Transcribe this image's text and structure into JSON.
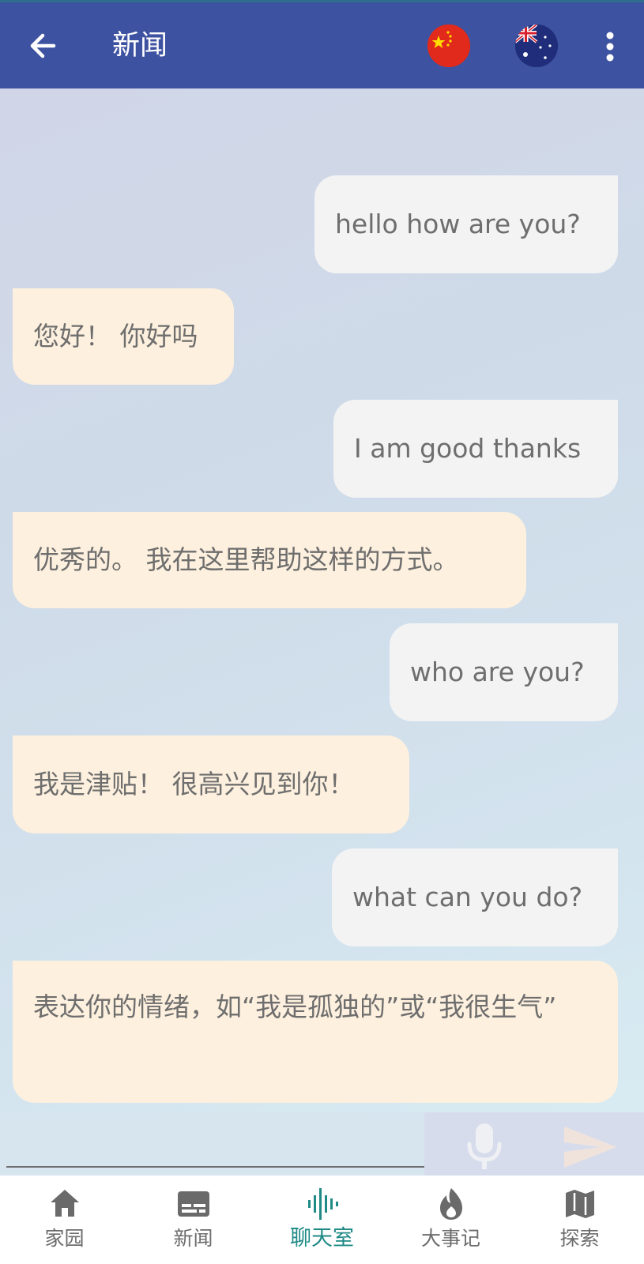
{
  "appbar": {
    "title": "新闻",
    "back_icon": "arrow-left-icon",
    "source_flag": "china-flag",
    "target_flag": "australia-flag",
    "menu_icon": "more-vertical-icon"
  },
  "messages": [
    {
      "side": "sent",
      "text": "hello how are you?"
    },
    {
      "side": "recv",
      "text": "您好！ 你好吗"
    },
    {
      "side": "sent",
      "text": "I am good thanks"
    },
    {
      "side": "recv",
      "text": "优秀的。 我在这里帮助这样的方式。"
    },
    {
      "side": "sent",
      "text": "who are you?"
    },
    {
      "side": "recv",
      "text": "我是津贴！ 很高兴见到你！"
    },
    {
      "side": "sent",
      "text": "what can you do?"
    },
    {
      "side": "recv",
      "text": "表达你的情绪，如“我是孤独的”或“我很生气”"
    }
  ],
  "composer": {
    "value": "",
    "mic_icon": "microphone-icon",
    "send_icon": "send-icon"
  },
  "bottom_nav": [
    {
      "label": "家园",
      "icon": "home-icon"
    },
    {
      "label": "新闻",
      "icon": "news-icon"
    },
    {
      "label": "聊天室",
      "icon": "voice-wave-icon",
      "active": true
    },
    {
      "label": "大事记",
      "icon": "flame-icon"
    },
    {
      "label": "探索",
      "icon": "map-icon"
    }
  ],
  "colors": {
    "appbar": "#3d52a0",
    "sent_bubble": "#f3f3f3",
    "received_bubble": "#fdf0de",
    "active_nav": "#1f8a86"
  }
}
